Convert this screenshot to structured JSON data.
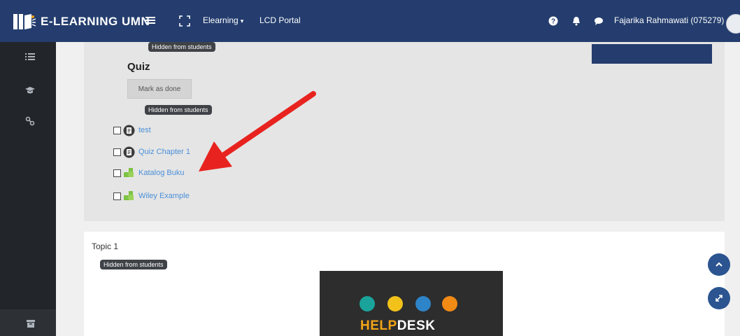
{
  "header": {
    "brand": "E-LEARNING UMN",
    "nav_elearning": "Elearning",
    "nav_lcd": "LCD Portal",
    "user_name": "Fajarika Rahmawati (075279)",
    "color_bg": "#243d6e"
  },
  "section": {
    "hidden_badge_top": "Hidden from students",
    "quiz_title": "Quiz",
    "mark_done": "Mark as done",
    "hidden_badge_quiz": "Hidden from students",
    "activities": [
      {
        "label": "test",
        "icon": "quiz-icon"
      },
      {
        "label": "Quiz Chapter 1",
        "icon": "quiz-icon"
      },
      {
        "label": "Katalog Buku",
        "icon": "puzzle-icon"
      },
      {
        "label": "Wiley Example",
        "icon": "puzzle-icon"
      }
    ]
  },
  "topic": {
    "title": "Topic 1",
    "hidden_badge": "Hidden from students",
    "helpdesk_help": "HELP",
    "helpdesk_desk": "DESK"
  },
  "annotation": {
    "arrow_color": "#e8231f"
  }
}
